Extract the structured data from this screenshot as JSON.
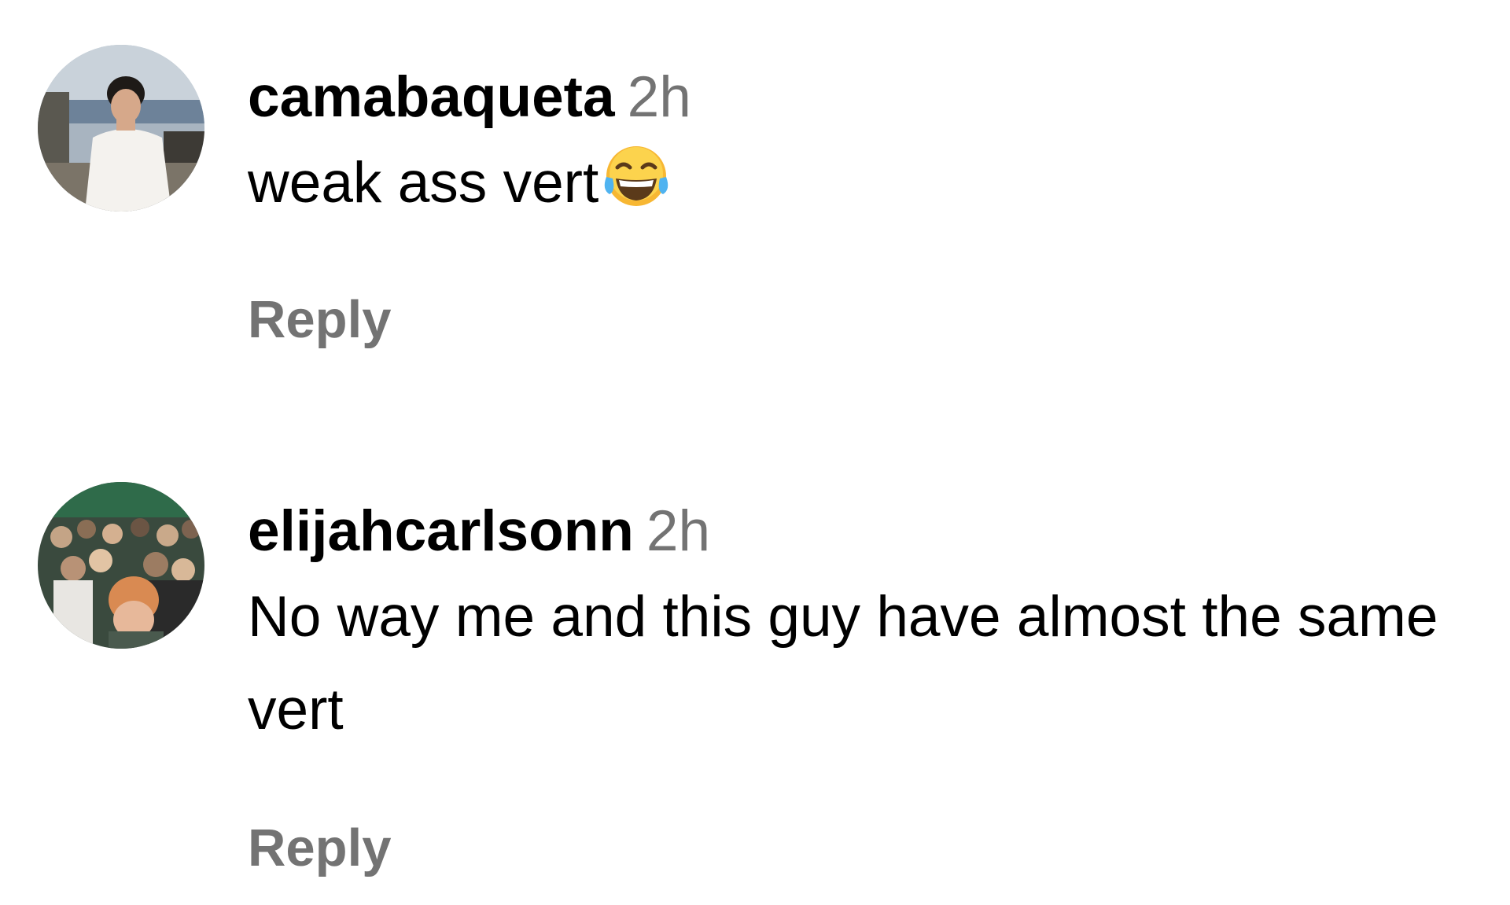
{
  "comments": [
    {
      "username": "camabaqueta",
      "time": "2h",
      "text": "weak ass vert",
      "emoji": "face-with-tears-of-joy",
      "reply_label": "Reply"
    },
    {
      "username": "elijahcarlsonn",
      "time": "2h",
      "text": "No way me and this guy have almost the same vert",
      "reply_label": "Reply"
    }
  ],
  "colors": {
    "text": "#000000",
    "secondary": "#737373",
    "background": "#ffffff"
  }
}
